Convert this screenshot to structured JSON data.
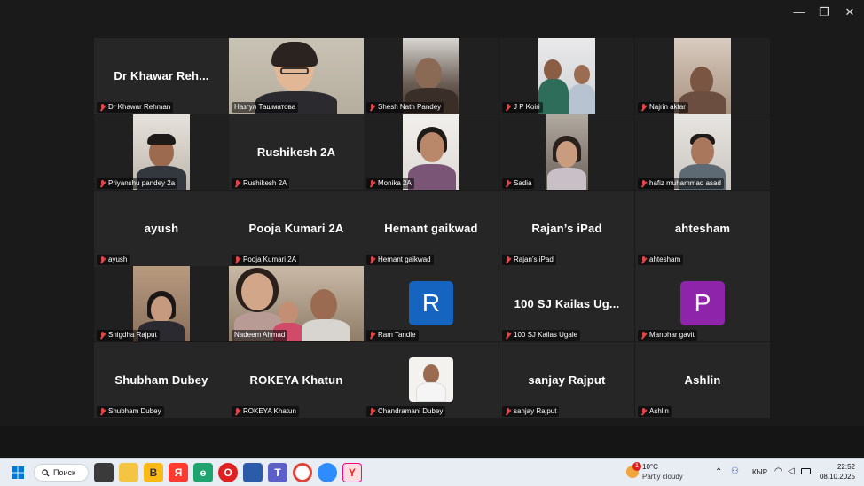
{
  "window": {
    "minimize": "—",
    "maximize": "❐",
    "close": "✕"
  },
  "participants": [
    {
      "id": "khawar",
      "big": "Dr Khawar Reh...",
      "label": "Dr Khawar Rehman",
      "muted": true
    },
    {
      "id": "nazgul",
      "big": "",
      "label": "Назгул Ташматова",
      "muted": false
    },
    {
      "id": "shesh",
      "big": "",
      "label": "Shesh Nath Pandey",
      "muted": true
    },
    {
      "id": "jp",
      "big": "",
      "label": "J P Koiri",
      "muted": true
    },
    {
      "id": "najrin",
      "big": "",
      "label": "Najrin aktar",
      "muted": true
    },
    {
      "id": "priyanshu",
      "big": "",
      "label": "Priyanshu pandey 2a",
      "muted": true
    },
    {
      "id": "rushikesh",
      "big": "Rushikesh 2A",
      "label": "Rushikesh 2A",
      "muted": true
    },
    {
      "id": "monika",
      "big": "",
      "label": "Monika  2A",
      "muted": true
    },
    {
      "id": "sadia",
      "big": "",
      "label": "Sadia",
      "muted": true
    },
    {
      "id": "hafiz",
      "big": "",
      "label": "hafiz muhammad asad",
      "muted": true
    },
    {
      "id": "ayush",
      "big": "ayush",
      "label": "ayush",
      "muted": true
    },
    {
      "id": "pooja",
      "big": "Pooja Kumari 2A",
      "label": "Pooja Kumari 2A",
      "muted": true
    },
    {
      "id": "hemant",
      "big": "Hemant gaikwad",
      "label": "Hemant gaikwad",
      "muted": true
    },
    {
      "id": "rajan",
      "big": "Rajan’s iPad",
      "label": "Rajan’s iPad",
      "muted": true
    },
    {
      "id": "ahtesham",
      "big": "ahtesham",
      "label": "ahtesham",
      "muted": true
    },
    {
      "id": "snigdha",
      "big": "",
      "label": "Snigdha Rajput",
      "muted": true
    },
    {
      "id": "nadeem",
      "big": "",
      "label": "Nadeem Ahmad",
      "muted": false
    },
    {
      "id": "ram",
      "big": "",
      "label": "Ram Tandle",
      "muted": true,
      "avatar": "R",
      "avatar_color": "#1565c0"
    },
    {
      "id": "kailas",
      "big": "100 SJ Kailas Ug...",
      "label": "100 SJ Kailas Ugale",
      "muted": true
    },
    {
      "id": "manohar",
      "big": "",
      "label": "Manohar gavit",
      "muted": true,
      "avatar": "P",
      "avatar_color": "#8e24aa"
    },
    {
      "id": "shubham",
      "big": "Shubham Dubey",
      "label": "Shubham Dubey",
      "muted": true
    },
    {
      "id": "rokeya",
      "big": "ROKEYA Khatun",
      "label": "ROKEYA Khatun",
      "muted": true
    },
    {
      "id": "chandramani",
      "big": "",
      "label": "Chandramani Dubey",
      "muted": true
    },
    {
      "id": "sanjay",
      "big": "sanjay Rajput",
      "label": "sanjay Rajput",
      "muted": true
    },
    {
      "id": "ashlin",
      "big": "Ashlin",
      "label": "Ashlin",
      "muted": true
    }
  ],
  "taskbar": {
    "search_label": "Поиск",
    "weather_temp": "10°C",
    "weather_cond": "Partly cloudy",
    "weather_badge": "1",
    "lang": "КЫР",
    "time": "22:52",
    "date": "08.10.2025"
  }
}
